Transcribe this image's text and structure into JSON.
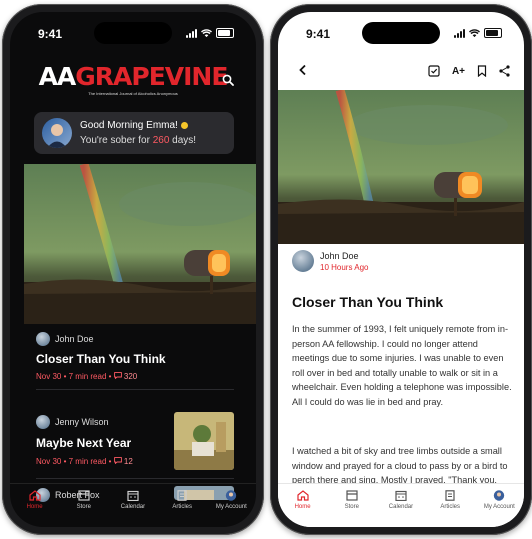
{
  "status": {
    "time": "9:41"
  },
  "home": {
    "logo_aa": "AA",
    "logo_grapevine": "GRAPEVINE",
    "logo_tagline": "The International Journal of Alcoholics Anonymous",
    "greeting_line1": "Good Morning Emma!",
    "greeting_line2_prefix": "You're sober for ",
    "greeting_days": "260",
    "greeting_line2_suffix": " days!",
    "articles": [
      {
        "author": "John Doe",
        "title": "Closer Than You Think",
        "date": "Nov 30",
        "read": "7 min read",
        "comments": "320"
      },
      {
        "author": "Jenny Wilson",
        "title": "Maybe Next Year",
        "date": "Nov 30",
        "read": "7 min read",
        "comments": "12"
      },
      {
        "author": "Robert Fox"
      }
    ]
  },
  "tabs": [
    "Home",
    "Store",
    "Calendar",
    "Articles",
    "My Account"
  ],
  "article": {
    "author": "John Doe",
    "time_ago": "10 Hours Ago",
    "title": "Closer Than You Think",
    "text_size_label": "A+",
    "paragraph1": "In the summer of 1993, I felt uniquely remote from in-person AA fellowship. I could no longer attend meetings due to some injuries. I was unable to even roll over in bed and totally unable to walk or sit in a wheelchair. Even holding a telephone was impossible. All I could do was lie in bed and pray.",
    "paragraph2": "I watched a bit of sky and tree limbs outside a small window and prayed for a cloud to pass by or a bird to perch there and sing. Mostly I prayed, \"Thank you, Great Spirit, I'm glad"
  },
  "colors": {
    "accent": "#e1262c",
    "dark_bg": "#0b0b0c",
    "card_bg": "#2b2b2f"
  }
}
